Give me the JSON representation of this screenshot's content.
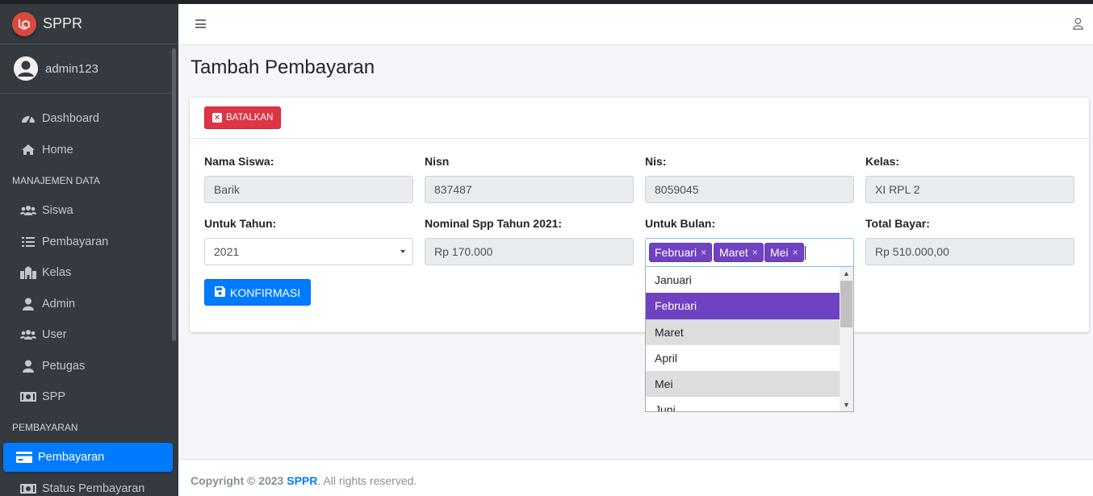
{
  "app": {
    "name": "SPPR",
    "accent": "#007bff"
  },
  "user": {
    "name": "admin123"
  },
  "sidebar": {
    "items": [
      {
        "label": "Dashboard",
        "icon": "tachometer-icon"
      },
      {
        "label": "Home",
        "icon": "home-icon"
      }
    ],
    "header_data": "MANAJEMEN DATA",
    "data_items": [
      {
        "label": "Siswa",
        "icon": "users-icon"
      },
      {
        "label": "Pembayaran",
        "icon": "list-icon"
      },
      {
        "label": "Kelas",
        "icon": "school-icon"
      },
      {
        "label": "Admin",
        "icon": "user-icon"
      },
      {
        "label": "User",
        "icon": "users-icon"
      },
      {
        "label": "Petugas",
        "icon": "user-icon"
      },
      {
        "label": "SPP",
        "icon": "money-icon"
      }
    ],
    "header_payment": "PEMBAYARAN",
    "payment_items": [
      {
        "label": "Pembayaran",
        "icon": "credit-card-icon",
        "active": true
      },
      {
        "label": "Status Pembayaran",
        "icon": "money-icon"
      }
    ]
  },
  "page": {
    "title": "Tambah Pembayaran"
  },
  "card": {
    "cancel_label": "BATALKAN",
    "confirm_label": "KONFIRMASI",
    "fields": {
      "nama_label": "Nama Siswa:",
      "nama_value": "Barik",
      "nisn_label": "Nisn",
      "nisn_value": "837487",
      "nis_label": "Nis:",
      "nis_value": "8059045",
      "kelas_label": "Kelas:",
      "kelas_value": "XI RPL 2",
      "tahun_label": "Untuk Tahun:",
      "tahun_value": "2021",
      "nominal_label": "Nominal Spp Tahun 2021:",
      "nominal_value": "Rp 170.000",
      "bulan_label": "Untuk Bulan:",
      "total_label": "Total Bayar:",
      "total_value": "Rp 510.000,00"
    },
    "selected_months": [
      "Februari",
      "Maret",
      "Mei"
    ],
    "remove_glyph": "×",
    "month_options": [
      "Januari",
      "Februari",
      "Maret",
      "April",
      "Mei",
      "Juni"
    ]
  },
  "footer": {
    "prefix": "Copyright © 2023",
    "brand": "SPPR",
    "suffix": ". All rights reserved."
  }
}
